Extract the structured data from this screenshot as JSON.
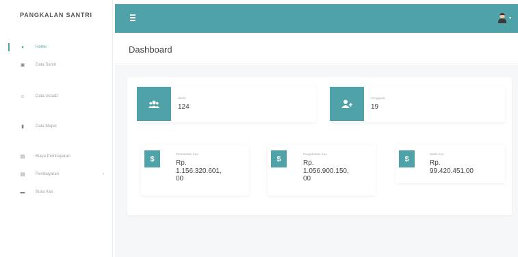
{
  "brand": "PANGKALAN SANTRI",
  "sidebar": {
    "items": [
      {
        "label": "Home",
        "icon": "home-icon"
      },
      {
        "label": "Data Santri",
        "icon": "id-card-icon"
      },
      {
        "label": "Data Ustadz",
        "icon": "user-tie-icon"
      },
      {
        "label": "Data Mapel",
        "icon": "book-icon"
      },
      {
        "label": "Biaya Pembayaran",
        "icon": "document-icon"
      },
      {
        "label": "Pembayaran",
        "icon": "document-icon"
      },
      {
        "label": "Buku Kas",
        "icon": "book-open-icon"
      }
    ]
  },
  "header": {
    "title": "Dashboard"
  },
  "stats": {
    "santri": {
      "label": "Santri",
      "value": "124"
    },
    "pengguna": {
      "label": "Pengguna",
      "value": "19"
    },
    "pemasukan": {
      "label": "Pemasukan Kas",
      "prefix": "Rp.",
      "value": "1.156.320.601,",
      "value2": "00"
    },
    "pengeluaran": {
      "label": "Pengeluaran Kas",
      "prefix": "Rp.",
      "value": "1.056.900.150,",
      "value2": "00"
    },
    "saldo": {
      "label": "Saldo Kas",
      "prefix": "Rp.",
      "value": "99.420.451,00"
    },
    "currency_symbol": "$"
  },
  "colors": {
    "accent": "#4fa3a8"
  }
}
